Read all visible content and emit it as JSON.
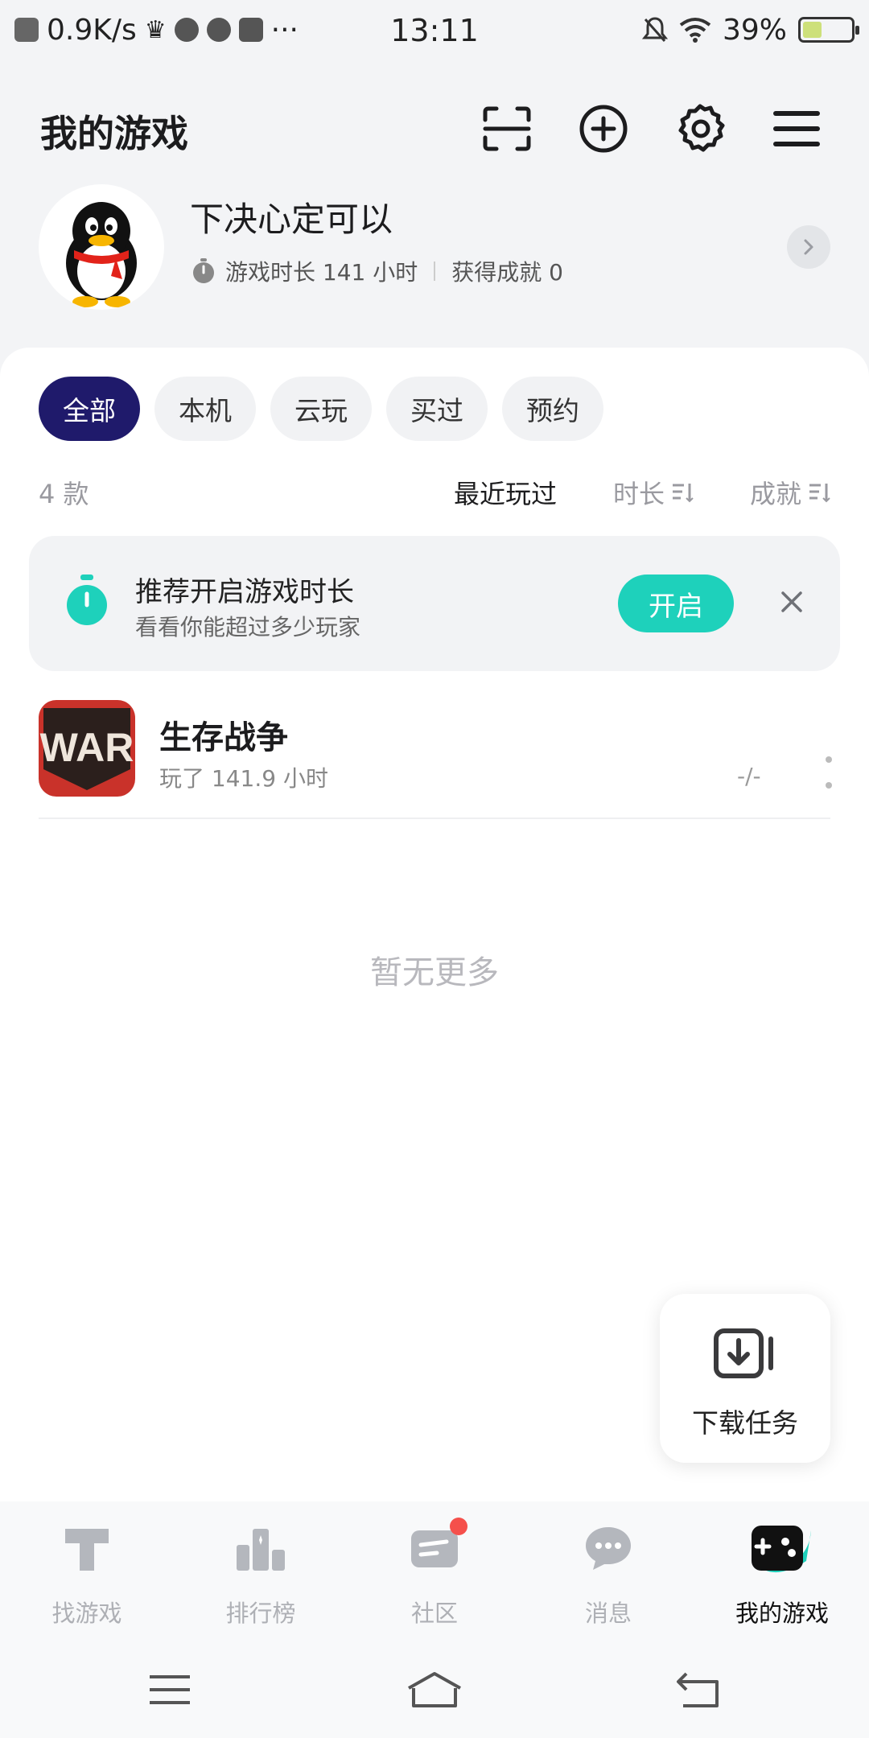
{
  "status_bar": {
    "speed": "0.9K/s",
    "time": "13:11",
    "battery": "39%",
    "battery_level": 0.39
  },
  "header": {
    "title": "我的游戏"
  },
  "profile": {
    "name": "下决心定可以",
    "playtime": "游戏时长 141 小时",
    "achievements": "获得成就 0"
  },
  "filters": [
    "全部",
    "本机",
    "云玩",
    "买过",
    "预约"
  ],
  "list": {
    "count": "4 款",
    "sort_recent": "最近玩过",
    "sort_duration": "时长",
    "sort_achievement": "成就"
  },
  "banner": {
    "title": "推荐开启游戏时长",
    "subtitle": "看看你能超过多少玩家",
    "button": "开启"
  },
  "games": [
    {
      "name": "生存战争",
      "played": "玩了 141.9 小时",
      "achievement": "-/-",
      "icon_text": "WAR"
    }
  ],
  "empty_text": "暂无更多",
  "download_task": "下载任务",
  "tabs": [
    {
      "label": "找游戏",
      "icon": "find-game-icon"
    },
    {
      "label": "排行榜",
      "icon": "ranking-icon"
    },
    {
      "label": "社区",
      "icon": "community-icon"
    },
    {
      "label": "消息",
      "icon": "message-icon"
    },
    {
      "label": "我的游戏",
      "icon": "my-games-icon"
    }
  ],
  "colors": {
    "accent": "#1ed1bb",
    "active_chip": "#1f1a6b",
    "badge": "#f5504b"
  }
}
